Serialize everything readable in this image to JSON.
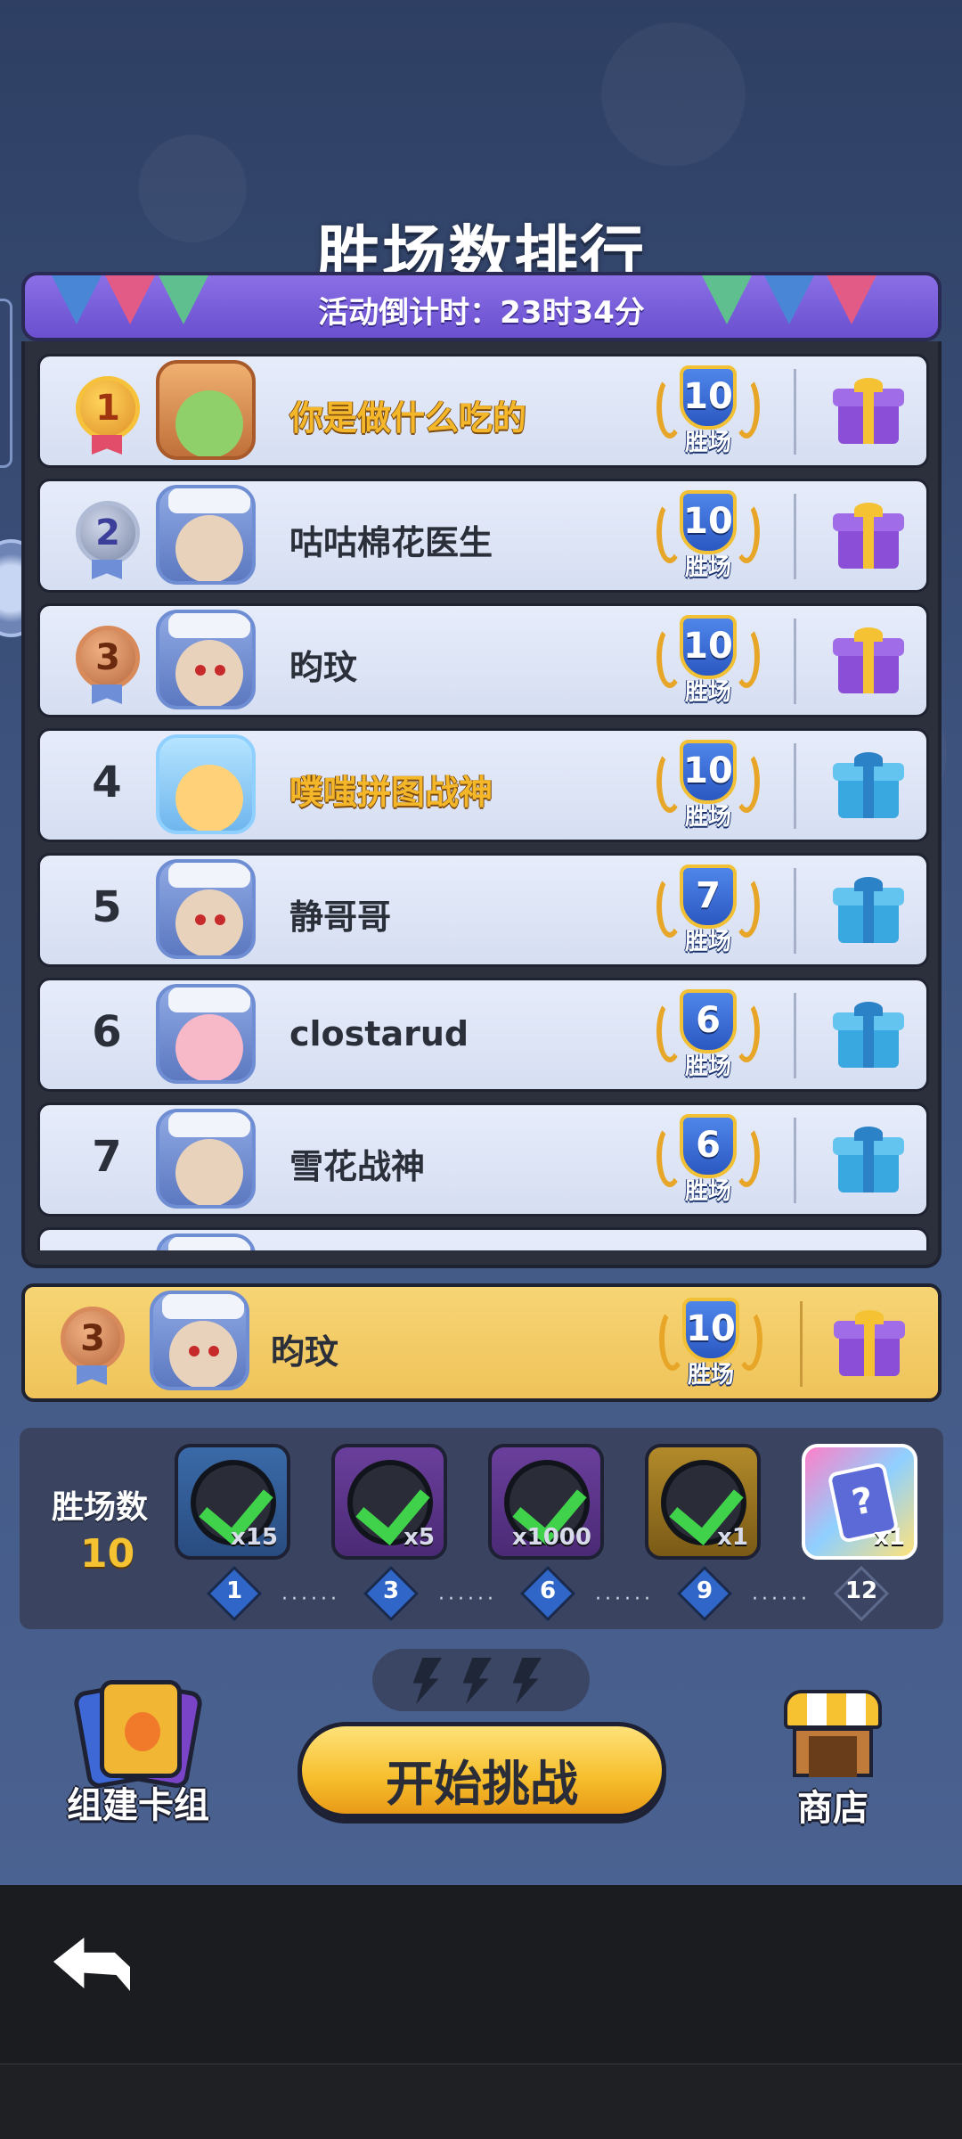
{
  "title": "胜场数排行",
  "countdown": "活动倒计时：23时34分",
  "wins_label": "胜场",
  "ranking": [
    {
      "rank": "1",
      "name": "你是做什么吃的",
      "wins": "10",
      "highlight": true,
      "gift": "purple-gift-icon"
    },
    {
      "rank": "2",
      "name": "咕咕棉花医生",
      "wins": "10",
      "highlight": false,
      "gift": "purple-gift-icon"
    },
    {
      "rank": "3",
      "name": "昀玟",
      "wins": "10",
      "highlight": false,
      "gift": "purple-gift-icon"
    },
    {
      "rank": "4",
      "name": "噗嗤拼图战神",
      "wins": "10",
      "highlight": true,
      "gift": "blue-gift-icon"
    },
    {
      "rank": "5",
      "name": "静哥哥",
      "wins": "7",
      "highlight": false,
      "gift": "blue-gift-icon"
    },
    {
      "rank": "6",
      "name": "clostarud",
      "wins": "6",
      "highlight": false,
      "gift": "blue-gift-icon"
    },
    {
      "rank": "7",
      "name": "雪花战神",
      "wins": "6",
      "highlight": false,
      "gift": "blue-gift-icon"
    }
  ],
  "self": {
    "rank": "3",
    "name": "昀玟",
    "wins": "10"
  },
  "progress": {
    "label": "胜场数",
    "value": "10",
    "rewards": [
      {
        "qty": "x15",
        "claimed": true
      },
      {
        "qty": "x5",
        "claimed": true
      },
      {
        "qty": "x1000",
        "claimed": true
      },
      {
        "qty": "x1",
        "claimed": true
      },
      {
        "qty": "x1",
        "claimed": false
      }
    ],
    "milestones": [
      "1",
      "3",
      "6",
      "9",
      "12"
    ],
    "dots": "······"
  },
  "buttons": {
    "deck": "组建卡组",
    "start": "开始挑战",
    "shop": "商店"
  },
  "colors": {
    "accent_gold": "#f6be2c",
    "banner_purple": "#6a4fcf",
    "check_green": "#3fd24a"
  }
}
